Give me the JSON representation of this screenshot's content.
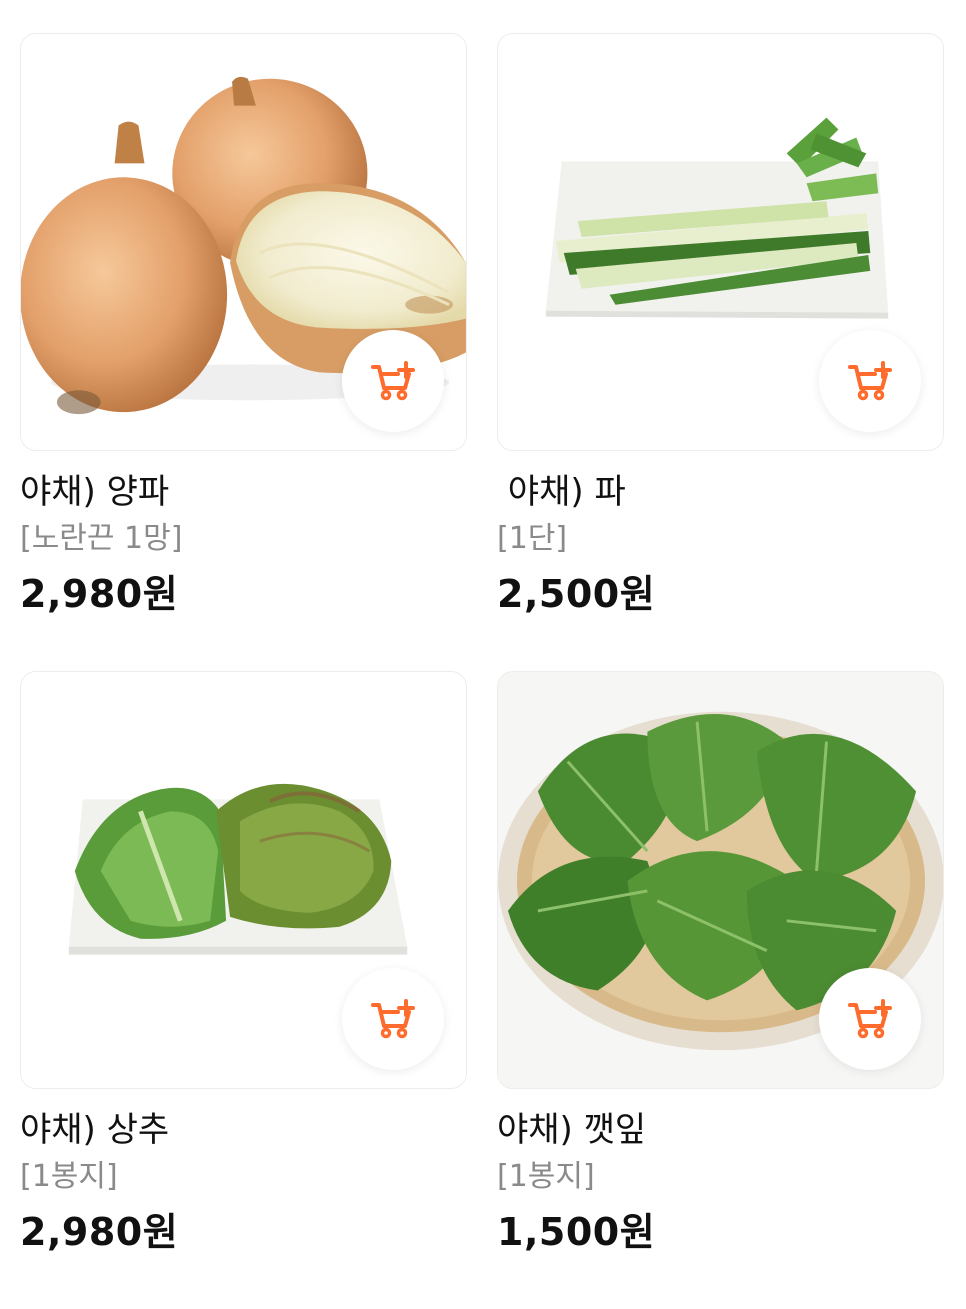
{
  "accent_color": "#ff6b2c",
  "cart_icon": "cart-add-icon",
  "products": [
    {
      "name": "야채) 양파",
      "unit": "[노란끈 1망]",
      "price": "2,980원",
      "image": "onion-image"
    },
    {
      "name": " 야채) 파",
      "unit": "[1단]",
      "price": "2,500원",
      "image": "green-onion-image"
    },
    {
      "name": "야채) 상추",
      "unit": "[1봉지]",
      "price": "2,980원",
      "image": "lettuce-image"
    },
    {
      "name": "야채) 깻잎",
      "unit": "[1봉지]",
      "price": "1,500원",
      "image": "perilla-leaf-image"
    }
  ]
}
